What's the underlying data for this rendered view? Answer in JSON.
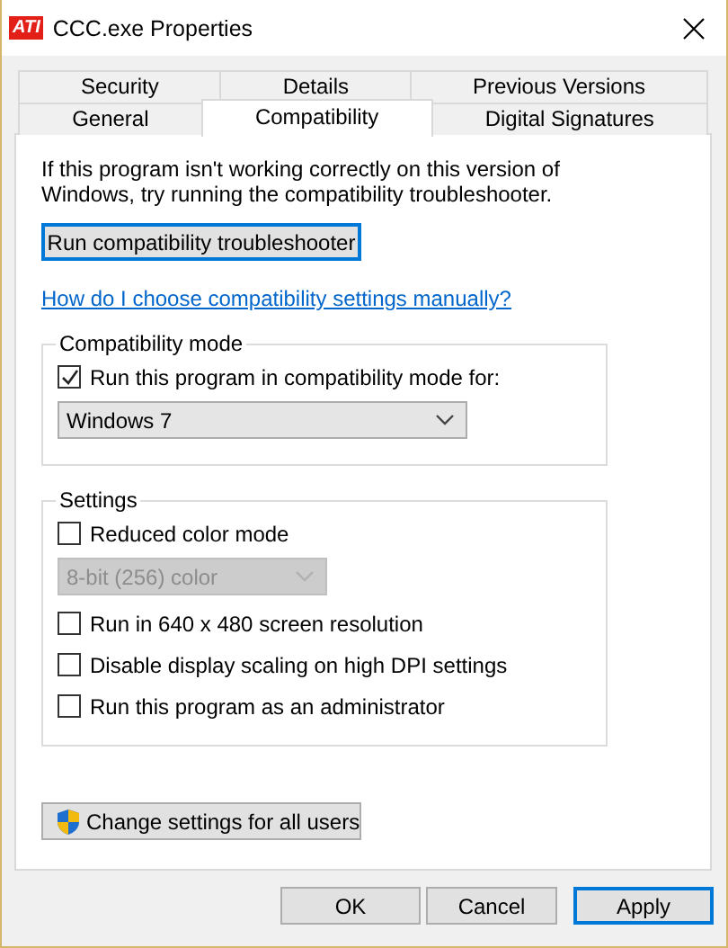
{
  "window": {
    "logo": "ATI",
    "title": "CCC.exe Properties"
  },
  "tab_rows": [
    {
      "tabs": [
        {
          "label": "Security",
          "selected": false
        },
        {
          "label": "Details",
          "selected": false
        },
        {
          "label": "Previous Versions",
          "selected": false
        }
      ]
    },
    {
      "tabs": [
        {
          "label": "General",
          "selected": false
        },
        {
          "label": "Compatibility",
          "selected": true
        },
        {
          "label": "Digital Signatures",
          "selected": false
        }
      ]
    }
  ],
  "intro": "If this program isn't working correctly on this version of Windows, try running the compatibility troubleshooter.",
  "troubleshoot_button": {
    "label": "Run compatibility troubleshooter",
    "focused": true
  },
  "help_link": "How do I choose compatibility settings manually?",
  "compat_group": {
    "title": "Compatibility mode",
    "items": [
      {
        "kind": "checkbox",
        "label": "Run this program in compatibility mode for:",
        "checked": true
      },
      {
        "kind": "select",
        "value": "Windows 7",
        "disabled": false
      }
    ]
  },
  "settings_group": {
    "title": "Settings",
    "items": [
      {
        "kind": "checkbox",
        "label": "Reduced color mode",
        "checked": false
      },
      {
        "kind": "select",
        "value": "8-bit (256) color",
        "disabled": true
      },
      {
        "kind": "checkbox",
        "label": "Run in 640 x 480 screen resolution",
        "checked": false
      },
      {
        "kind": "checkbox",
        "label": "Disable display scaling on high DPI settings",
        "checked": false
      },
      {
        "kind": "checkbox",
        "label": "Run this program as an administrator",
        "checked": false
      }
    ]
  },
  "all_users_button": {
    "label": "Change settings for all users",
    "focused": false
  },
  "buttons": [
    {
      "label": "OK",
      "focused": false
    },
    {
      "label": "Cancel",
      "focused": false
    },
    {
      "label": "Apply",
      "focused": true
    }
  ]
}
